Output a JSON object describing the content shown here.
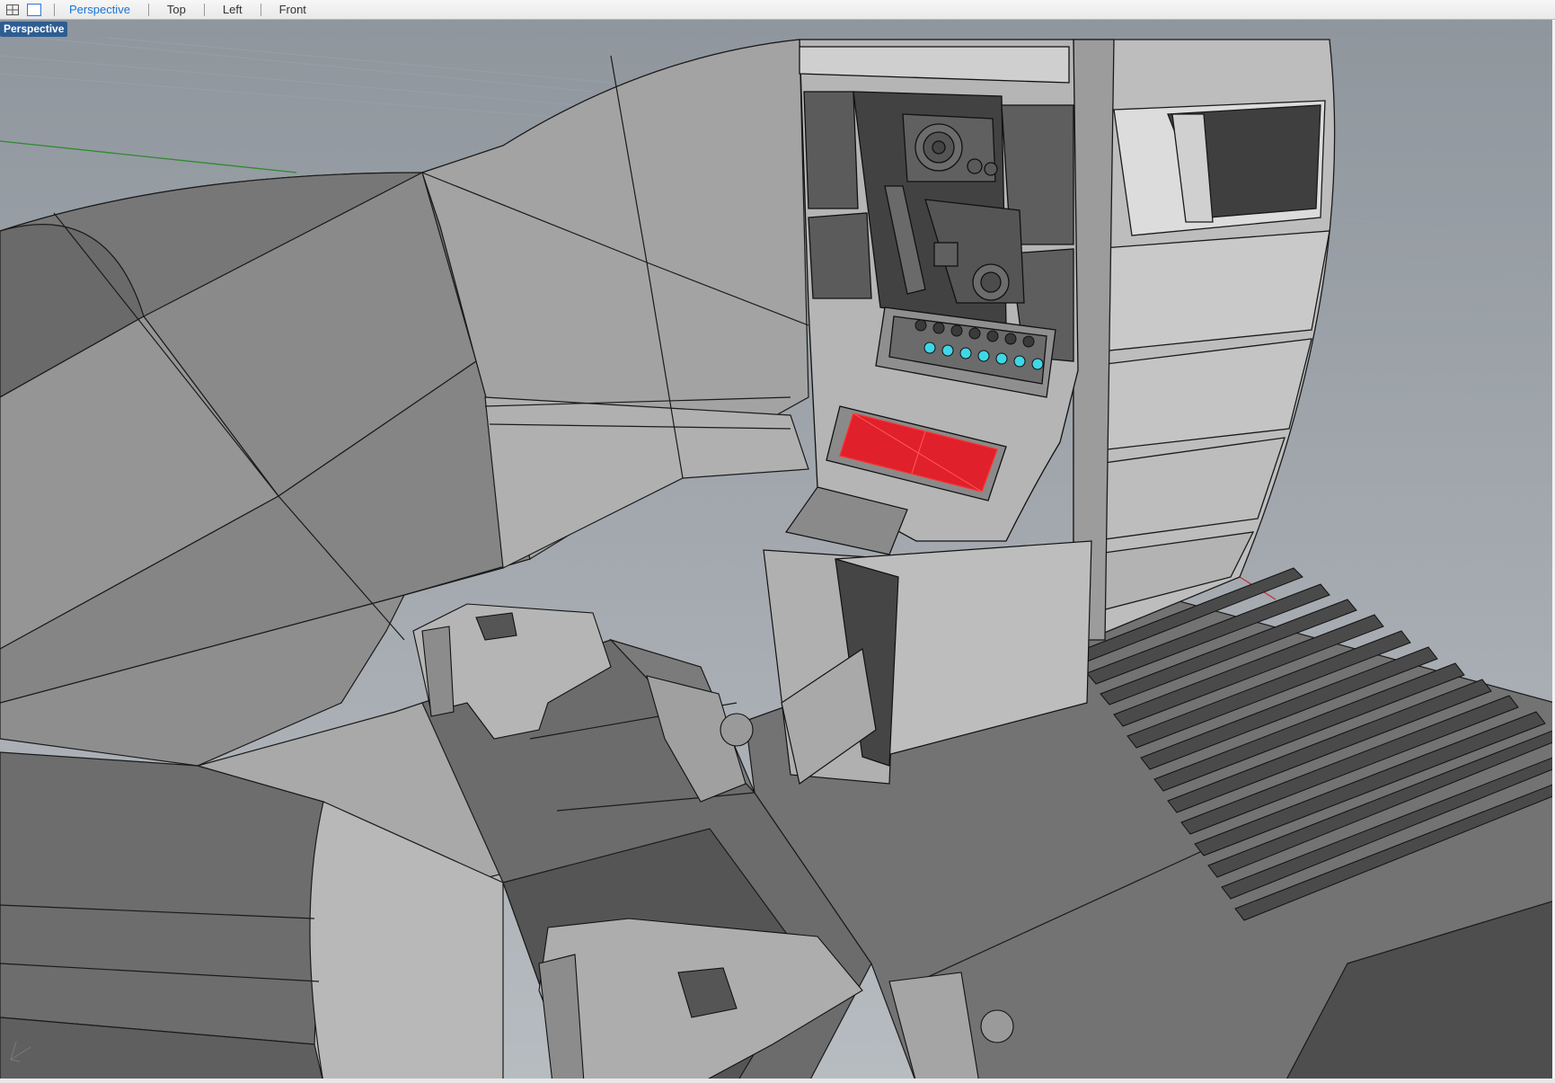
{
  "tabbar": {
    "layout_icons": [
      "four-viewports-icon",
      "single-viewport-icon"
    ],
    "tabs": [
      {
        "label": "Perspective",
        "active": true
      },
      {
        "label": "Top",
        "active": false
      },
      {
        "label": "Left",
        "active": false
      },
      {
        "label": "Front",
        "active": false
      }
    ]
  },
  "viewport": {
    "label": "Perspective",
    "background_color": "#a6adb4",
    "selected_color": "#e0202a",
    "highlight_color": "#3fd7e8"
  }
}
